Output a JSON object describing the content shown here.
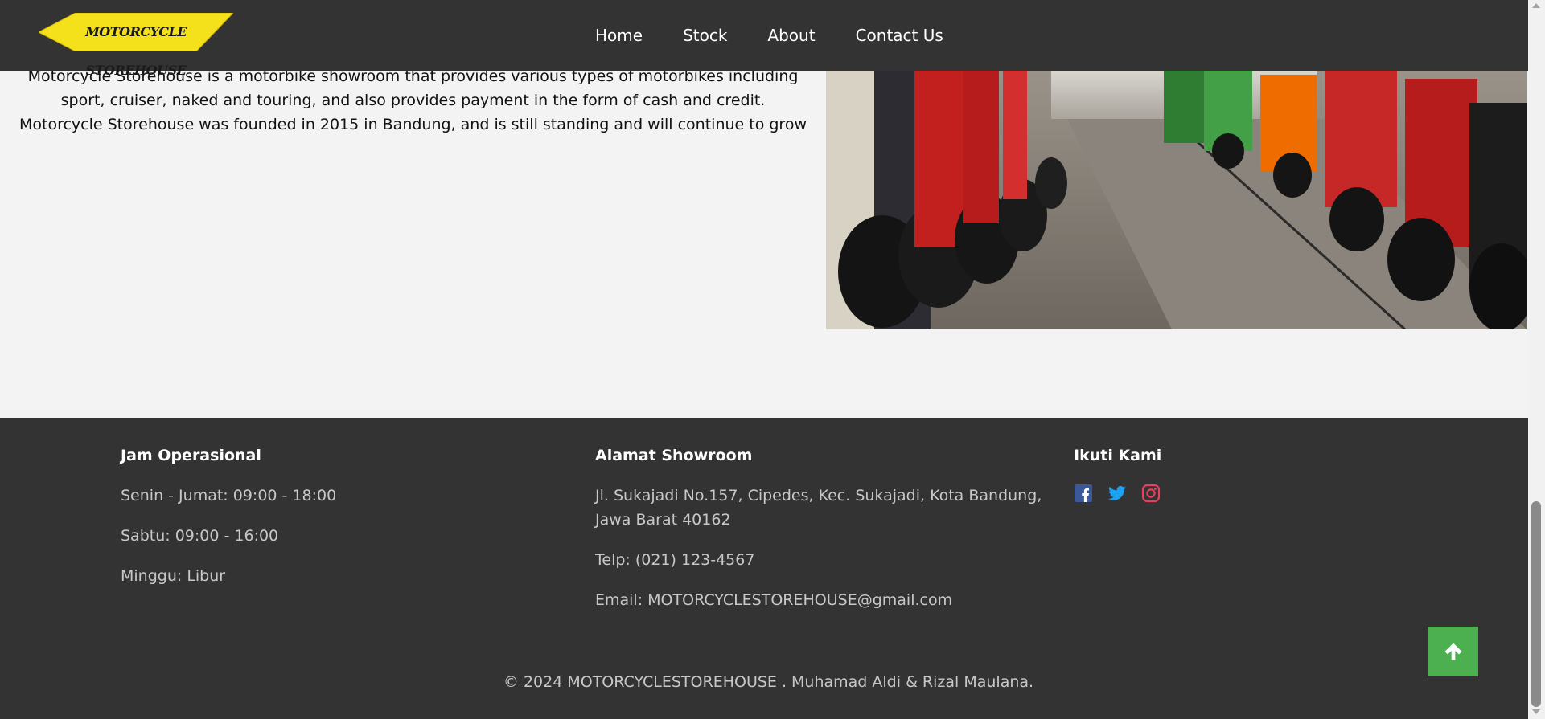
{
  "header": {
    "logo_text": "MOTORCYCLE STOREHOUSE",
    "nav": [
      "Home",
      "Stock",
      "About",
      "Contact Us"
    ]
  },
  "about": {
    "lines": [
      "Motorcycle Storehouse is a motorbike showroom that provides various types of motorbikes including",
      "sport, cruiser, naked and touring, and also provides payment in the form of cash and credit.",
      "Motorcycle Storehouse was founded in 2015 in Bandung, and is still standing and will continue to grow"
    ]
  },
  "footer": {
    "hours": {
      "title": "Jam Operasional",
      "items": [
        "Senin - Jumat: 09:00 - 18:00",
        "Sabtu: 09:00 - 16:00",
        "Minggu: Libur"
      ]
    },
    "address": {
      "title": "Alamat Showroom",
      "street_line1": "Jl. Sukajadi No.157, Cipedes, Kec. Sukajadi, Kota Bandung,",
      "street_line2": "Jawa Barat 40162",
      "phone": "Telp: (021) 123-4567",
      "email": "Email: MOTORCYCLESTOREHOUSE@gmail.com"
    },
    "social": {
      "title": "Ikuti Kami",
      "icons": [
        "facebook-icon",
        "twitter-icon",
        "instagram-icon"
      ]
    },
    "copyright": "© 2024 MOTORCYCLESTOREHOUSE . Muhamad Aldi & Rizal Maulana."
  },
  "colors": {
    "header_bg": "#333333",
    "logo_yellow": "#f5e11b",
    "back_to_top": "#4caf50",
    "facebook": "#3b5998",
    "twitter": "#1da1f2",
    "instagram": "#e4405f"
  }
}
